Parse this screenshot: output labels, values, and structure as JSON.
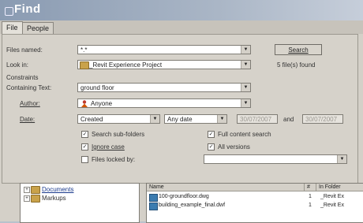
{
  "window": {
    "title": "Find"
  },
  "tabs": [
    {
      "label": "File",
      "active": true
    },
    {
      "label": "People",
      "active": false
    }
  ],
  "form": {
    "files_named_label": "Files named:",
    "files_named_value": "*.*",
    "look_in_label": "Look in:",
    "look_in_value": "_Revit Experience Project",
    "constraints_label": "Constraints",
    "containing_text_label": "Containing Text:",
    "containing_text_value": "ground floor",
    "author_label": "Author:",
    "author_value": "Anyone",
    "date_label": "Date:",
    "date_type_value": "Created",
    "date_range_value": "Any date",
    "date_from_value": "30/07/2007",
    "and_label": "and",
    "date_to_value": "30/07/2007"
  },
  "actions": {
    "search_label": "Search",
    "status_text": "5 file(s) found"
  },
  "options": {
    "search_subfolders": {
      "label": "Search sub-folders",
      "checked": true
    },
    "ignore_case": {
      "label": "Ignore case",
      "checked": true
    },
    "files_locked_by": {
      "label": "Files locked by:",
      "checked": false
    },
    "full_content_search": {
      "label": "Full content search",
      "checked": true
    },
    "all_versions": {
      "label": "All versions",
      "checked": true
    },
    "locked_by_value": ""
  },
  "tree": {
    "items": [
      {
        "label": "Documents"
      },
      {
        "label": "Markups"
      }
    ]
  },
  "results": {
    "columns": {
      "name": "Name",
      "flag": "#",
      "folder": "In Folder"
    },
    "rows": [
      {
        "name": "100-groundfloor.dwg",
        "flag": "1",
        "folder": "_Revit Ex"
      },
      {
        "name": "building_example_final.dwf",
        "flag": "1",
        "folder": "_Revit Ex"
      }
    ]
  },
  "colors": {
    "titlebar": "#8a9bb2",
    "panel": "#d4d0c8",
    "link": "#1a3a8c"
  }
}
